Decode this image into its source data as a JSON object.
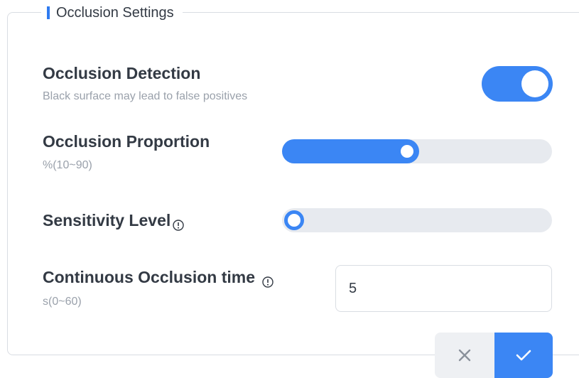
{
  "section": {
    "title": "Occlusion Settings"
  },
  "occlusion_detection": {
    "label": "Occlusion Detection",
    "description": "Black surface may lead to false positives",
    "enabled": true
  },
  "occlusion_proportion": {
    "label": "Occlusion Proportion",
    "range_hint": "%(10~90)",
    "value_fraction": 0.46
  },
  "sensitivity_level": {
    "label": "Sensitivity Level",
    "info_icon": "info-circle-icon",
    "value_fraction": 0.0
  },
  "continuous_occlusion_time": {
    "label": "Continuous Occlusion time",
    "info_icon": "info-circle-icon",
    "range_hint": "s(0~60)",
    "value": "5"
  },
  "actions": {
    "cancel_icon": "close-icon",
    "confirm_icon": "check-icon"
  },
  "colors": {
    "accent": "#3b86f4",
    "track": "#e7eaef",
    "text_primary": "#333a44",
    "text_secondary": "#9aa1ab"
  }
}
